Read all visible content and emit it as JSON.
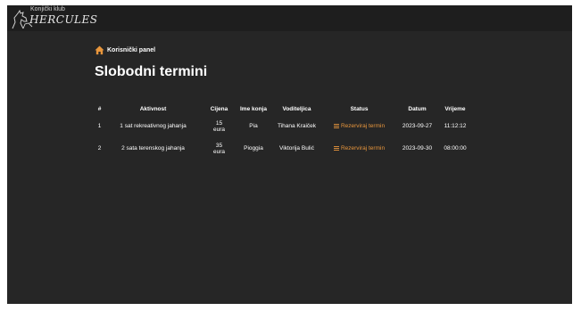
{
  "brand": {
    "subtitle": "Konjički klub",
    "name": "HERCULES",
    "logo_icon": "horse-logo-icon"
  },
  "breadcrumb": {
    "icon": "home-icon",
    "label": "Korisnički panel"
  },
  "page": {
    "title": "Slobodni termini"
  },
  "table": {
    "headers": [
      "#",
      "Aktivnost",
      "Cijena",
      "Ime konja",
      "Voditeljica",
      "Status",
      "Datum",
      "Vrijeme"
    ],
    "rows": [
      {
        "num": "1",
        "activity": "1 sat rekreativnog jahanja",
        "price_value": "15",
        "price_unit": "eura",
        "horse": "Pia",
        "instructor": "Tihana Kraiček",
        "action": "Rezerviraj termin",
        "date": "2023-09-27",
        "time": "11:12:12"
      },
      {
        "num": "2",
        "activity": "2 sata terenskog jahanja",
        "price_value": "35",
        "price_unit": "eura",
        "horse": "Pioggia",
        "instructor": "Viktorija Bulić",
        "action": "Rezerviraj termin",
        "date": "2023-09-30",
        "time": "08:00:00"
      }
    ]
  },
  "colors": {
    "background": "#262626",
    "topbar": "#1e1e1e",
    "accent": "#e8963c",
    "text": "#ffffff"
  }
}
